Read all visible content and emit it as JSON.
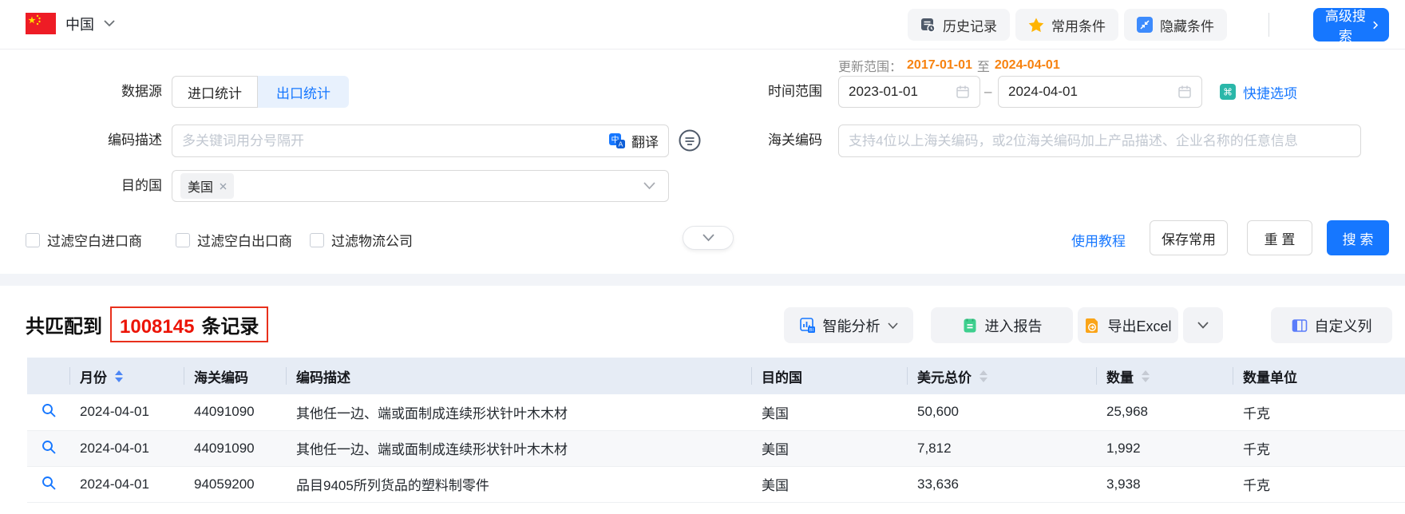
{
  "colors": {
    "primary_blue": "#1677ff",
    "update_orange": "#f7820f",
    "count_red": "#ec1407",
    "star_yellow": "#ffb400",
    "quick_teal": "#2ab7a9",
    "report_green": "#3ecf8e",
    "excel_orange": "#faa419",
    "table_header_bg": "#e6ecf5"
  },
  "topbar": {
    "country_label": "中国",
    "history_btn": "历史记录",
    "favorites_btn": "常用条件",
    "hide_btn": "隐藏条件",
    "advanced_btn": "高级搜索"
  },
  "form": {
    "update_range": {
      "label": "更新范围：",
      "start": "2017-01-01",
      "joiner": "至",
      "end": "2024-04-01"
    },
    "data_source": {
      "label": "数据源",
      "import_option": "进口统计",
      "export_option": "出口统计",
      "selected": "出口统计"
    },
    "time_range": {
      "label": "时间范围",
      "start_value": "2023-01-01",
      "end_value": "2024-04-01",
      "separator": "–",
      "quick_options": "快捷选项"
    },
    "code_desc": {
      "label": "编码描述",
      "placeholder": "多关键词用分号隔开",
      "translate_label": "翻译"
    },
    "hs_code": {
      "label": "海关编码",
      "placeholder": "支持4位以上海关编码，或2位海关编码加上产品描述、企业名称的任意信息"
    },
    "dest_country": {
      "label": "目的国",
      "selected_tag": "美国"
    },
    "filters": [
      "过滤空白进口商",
      "过滤空白出口商",
      "过滤物流公司"
    ],
    "tutorial_link": "使用教程",
    "save_btn": "保存常用",
    "reset_btn": "重 置",
    "search_btn": "搜 索"
  },
  "results": {
    "count_prefix": "共匹配到",
    "count_value": "1008145",
    "count_suffix": "条记录",
    "analysis_btn": "智能分析",
    "report_btn": "进入报告",
    "export_btn": "导出Excel",
    "custom_columns_btn": "自定义列",
    "table": {
      "headers": [
        "月份",
        "海关编码",
        "编码描述",
        "目的国",
        "美元总价",
        "数量",
        "数量单位"
      ],
      "rows": [
        [
          "2024-04-01",
          "44091090",
          "其他任一边、端或面制成连续形状针叶木木材",
          "美国",
          "50,600",
          "25,968",
          "千克"
        ],
        [
          "2024-04-01",
          "44091090",
          "其他任一边、端或面制成连续形状针叶木木材",
          "美国",
          "7,812",
          "1,992",
          "千克"
        ],
        [
          "2024-04-01",
          "94059200",
          "品目9405所列货品的塑料制零件",
          "美国",
          "33,636",
          "3,938",
          "千克"
        ]
      ]
    }
  }
}
